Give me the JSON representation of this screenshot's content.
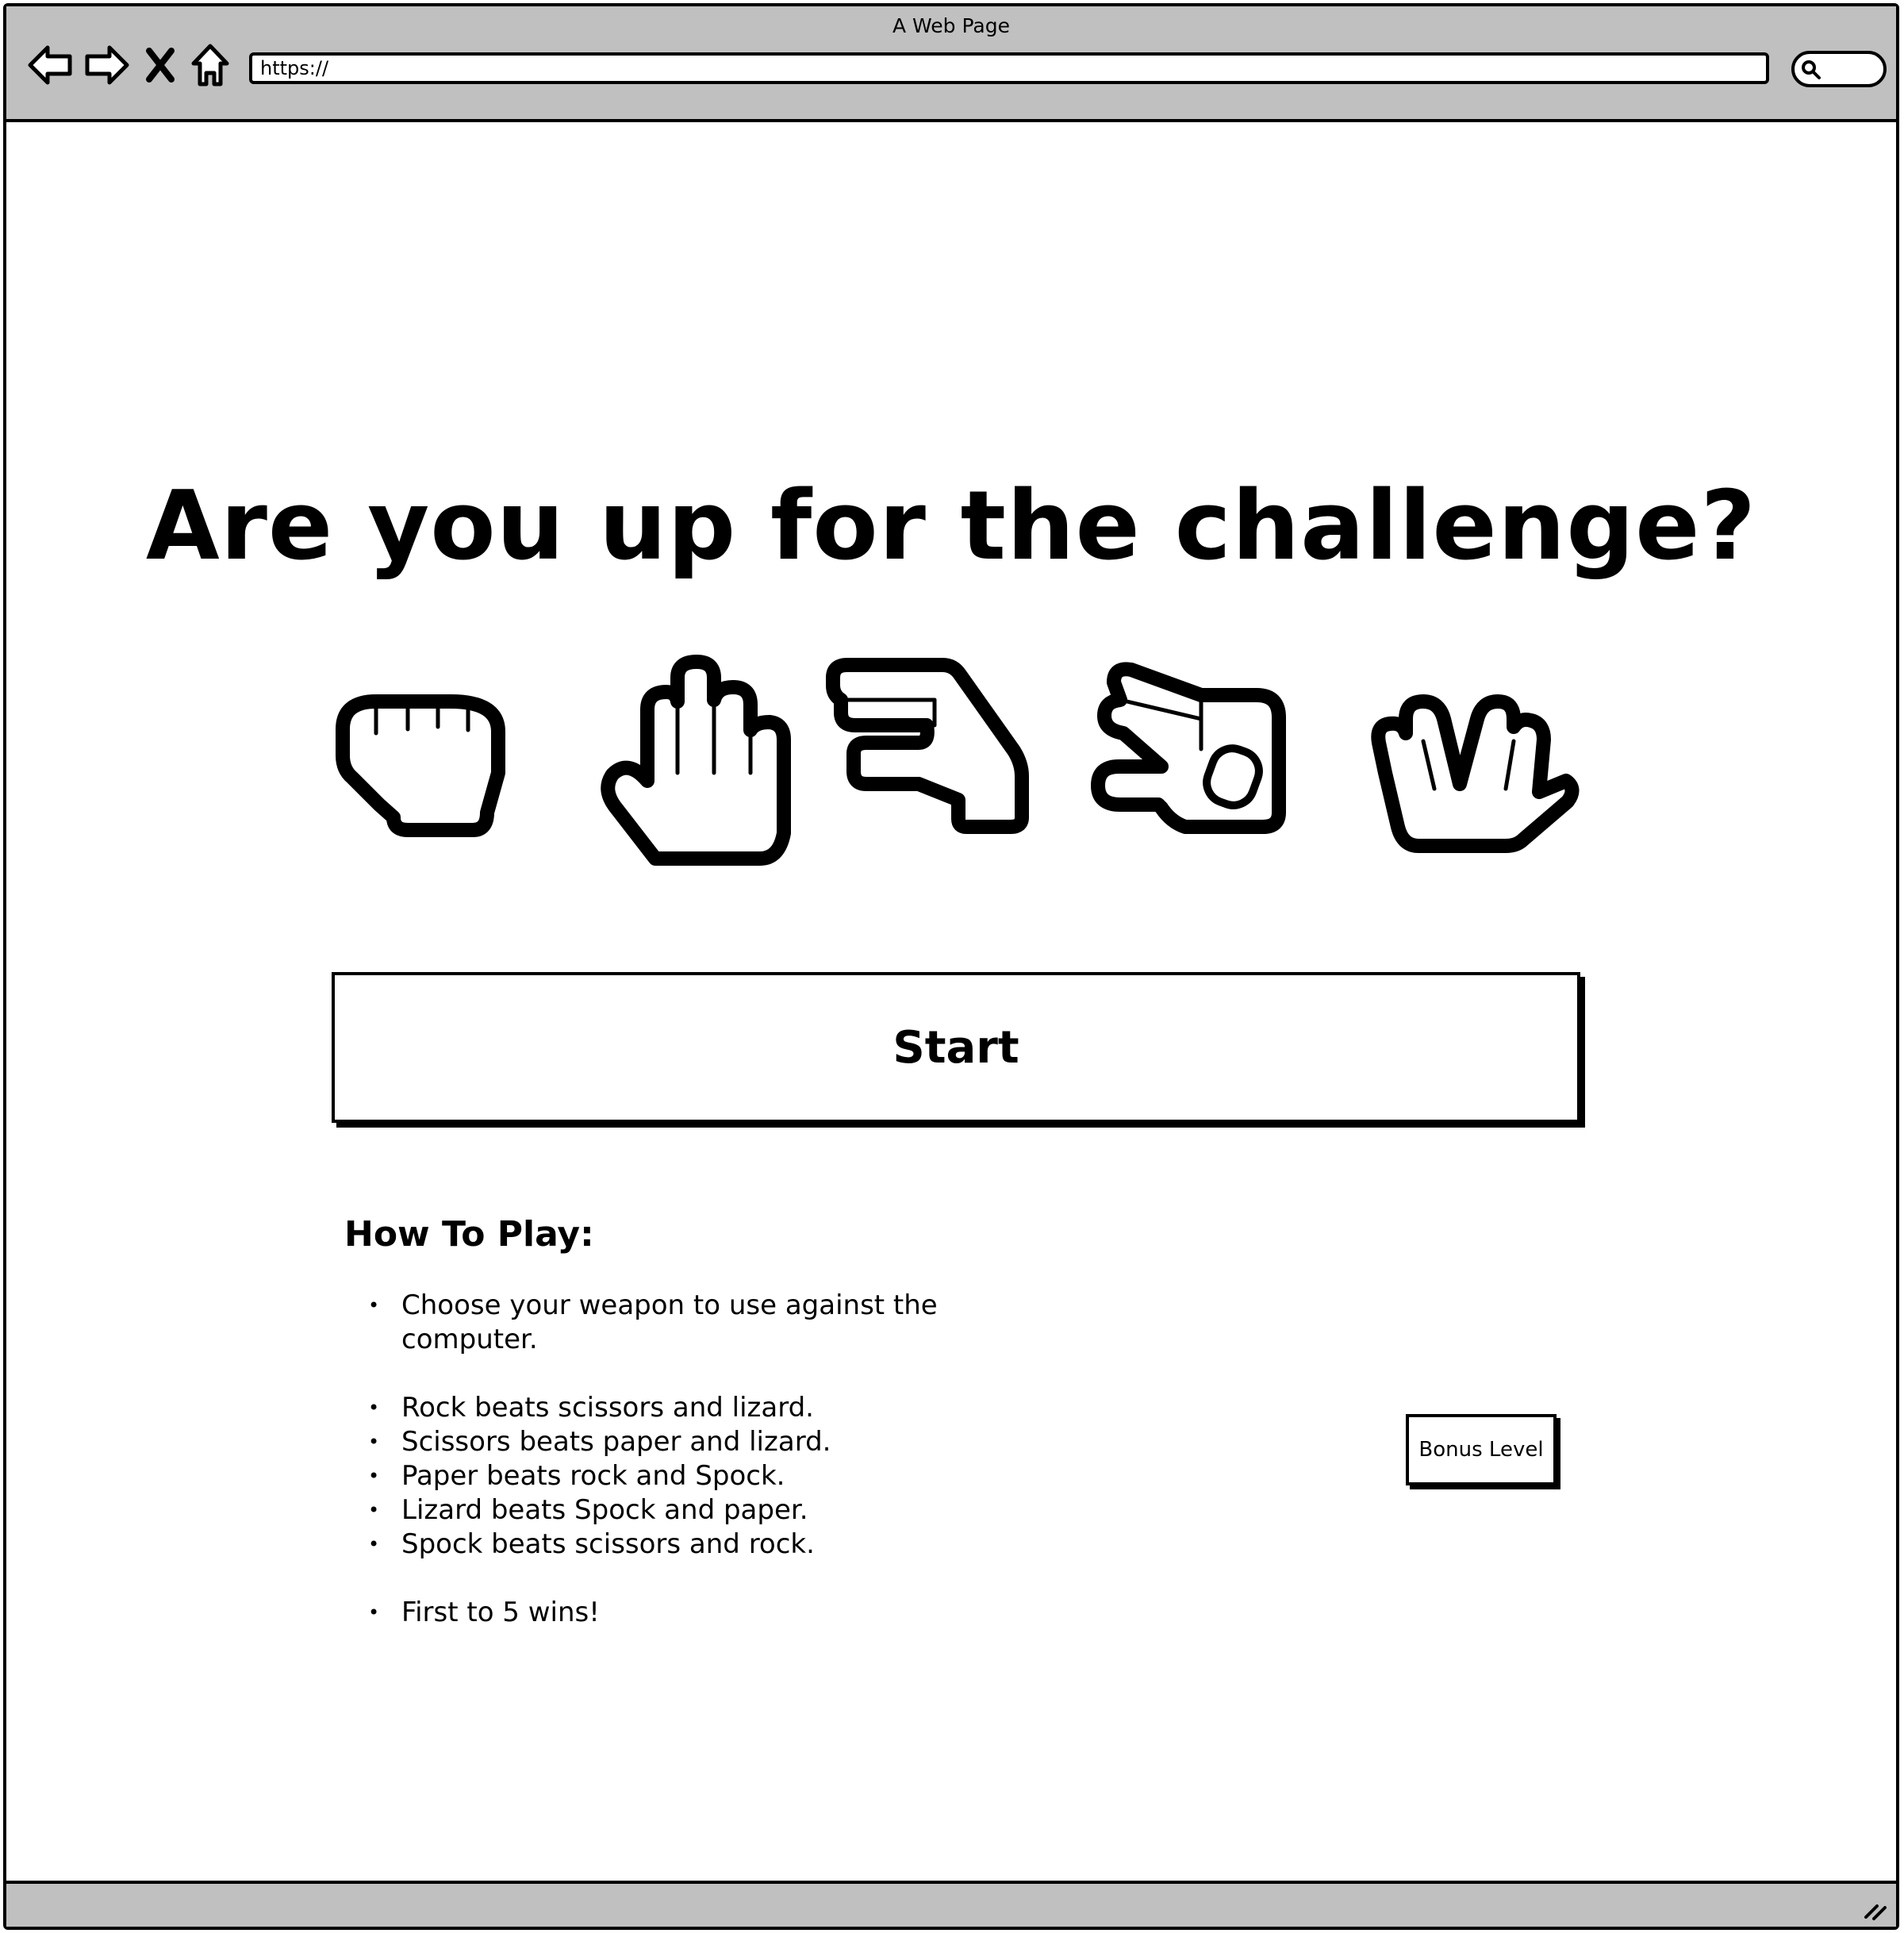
{
  "window": {
    "title": "A Web Page"
  },
  "browser": {
    "url": "https://",
    "nav_icons": [
      "back-arrow-icon",
      "forward-arrow-icon",
      "stop-x-icon",
      "home-icon"
    ],
    "search_icon": "magnifier-icon"
  },
  "page": {
    "heading": "Are you up for the challenge?",
    "weapons": [
      "rock-hand-icon",
      "paper-hand-icon",
      "scissors-hand-icon",
      "lizard-hand-icon",
      "spock-hand-icon"
    ],
    "start_label": "Start",
    "howto_title": "How To Play:",
    "rules": [
      "Choose your weapon to use against the computer.",
      "Rock beats scissors and lizard.",
      "Scissors beats paper and lizard.",
      "Paper beats rock and Spock.",
      "Lizard beats Spock and paper.",
      "Spock beats scissors and rock.",
      "First to 5 wins!"
    ],
    "bonus_label": "Bonus Level"
  },
  "colors": {
    "chrome": "#c0c0c0",
    "ink": "#000000",
    "background": "#ffffff"
  }
}
